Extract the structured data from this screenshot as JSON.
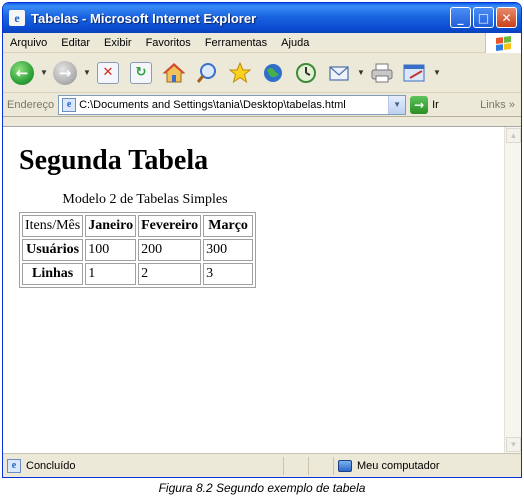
{
  "window": {
    "title": "Tabelas - Microsoft Internet Explorer"
  },
  "menu": {
    "items": [
      "Arquivo",
      "Editar",
      "Exibir",
      "Favoritos",
      "Ferramentas",
      "Ajuda"
    ]
  },
  "toolbar": {
    "buttons": [
      "back-icon",
      "forward-icon",
      "stop-icon",
      "refresh-icon",
      "home-icon",
      "search-icon",
      "favorites-icon",
      "media-icon",
      "history-icon",
      "mail-icon",
      "print-icon",
      "edit-icon"
    ]
  },
  "address": {
    "label": "Endereço",
    "url": "C:\\Documents and Settings\\tania\\Desktop\\tabelas.html",
    "go_label": "Ir",
    "links_label": "Links"
  },
  "page": {
    "heading": "Segunda Tabela",
    "caption": "Modelo 2 de Tabelas Simples",
    "table": {
      "headers": [
        "Itens/Mês",
        "Janeiro",
        "Fevereiro",
        "Março"
      ],
      "rows": [
        {
          "label": "Usuários",
          "values": [
            "100",
            "200",
            "300"
          ]
        },
        {
          "label": "Linhas",
          "values": [
            "1",
            "2",
            "3"
          ]
        }
      ]
    }
  },
  "status": {
    "text": "Concluído",
    "zone": "Meu computador"
  },
  "figure_caption": "Figura 8.2 Segundo exemplo de tabela",
  "colors": {
    "titlebar": "#0a5ee8",
    "back": "#2fa33a",
    "close": "#c8421b"
  }
}
